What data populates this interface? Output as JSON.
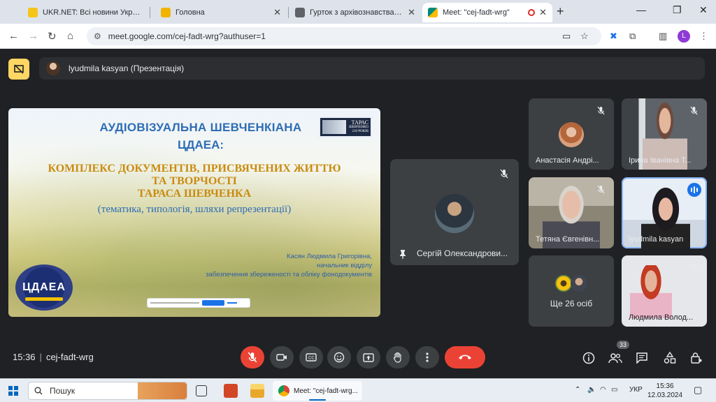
{
  "browser": {
    "tabs": [
      {
        "title": "UKR.NET: Всі новини України, о",
        "fav_color": "#f5c518",
        "active": false
      },
      {
        "title": "Головна",
        "fav_color": "#f0b400",
        "active": false
      },
      {
        "title": "Гурток з архівознавства Кафед",
        "fav_color": "#5f6368",
        "active": false
      },
      {
        "title": "Meet: \"cej-fadt-wrg\"",
        "fav_color": "#00897b",
        "active": true
      }
    ],
    "url": "meet.google.com/cej-fadt-wrg?authuser=1",
    "profile_initial": "L"
  },
  "meet": {
    "presenter_label": "lyudmila kasyan (Презентація)",
    "slide": {
      "title_line1": "АУДІОВІЗУАЛЬНА ШЕВЧЕНКІАНА",
      "title_line2": "ЦДАЕА:",
      "subtitle_line1": "КОМПЛЕКС ДОКУМЕНТІВ, ПРИСВЯЧЕНИХ ЖИТТЮ",
      "subtitle_line2": "ТА ТВОРЧОСТІ",
      "subtitle_line3": "ТАРАСА ШЕВЧЕНКА",
      "subtitle_line4": "(тематика, типологія, шляхи репрезентації)",
      "author_line1": "Касян Людмила Григорівна,",
      "author_line2": "начальник відділу",
      "author_line3": "забезпечення збереженості та обліку фонодокументів",
      "logo_taras_text1": "ТАРАС",
      "logo_taras_text2": "ШЕВЧЕНКО",
      "logo_taras_text3": "210 РОКІВ",
      "logo_cdaea": "ЦДАЕА"
    },
    "center_participant": "Сергій Олександрови...",
    "participants": [
      {
        "name": "Анастасія Андрі...",
        "muted": true
      },
      {
        "name": "Ірина Іванівна Т...",
        "muted": true
      },
      {
        "name": "Тетяна Євгенівн...",
        "muted": true
      },
      {
        "name": "lyudmila kasyan",
        "muted": false
      },
      {
        "name": "Людмила Волод...",
        "muted": true
      }
    ],
    "more_label": "Ще 26 осіб",
    "time": "15:36",
    "meeting_code": "cej-fadt-wrg",
    "people_count": "33"
  },
  "taskbar": {
    "search_placeholder": "Пошук",
    "active_app": "Meet: \"cej-fadt-wrg...",
    "language": "УКР",
    "time": "15:36",
    "date": "12.03.2024"
  }
}
